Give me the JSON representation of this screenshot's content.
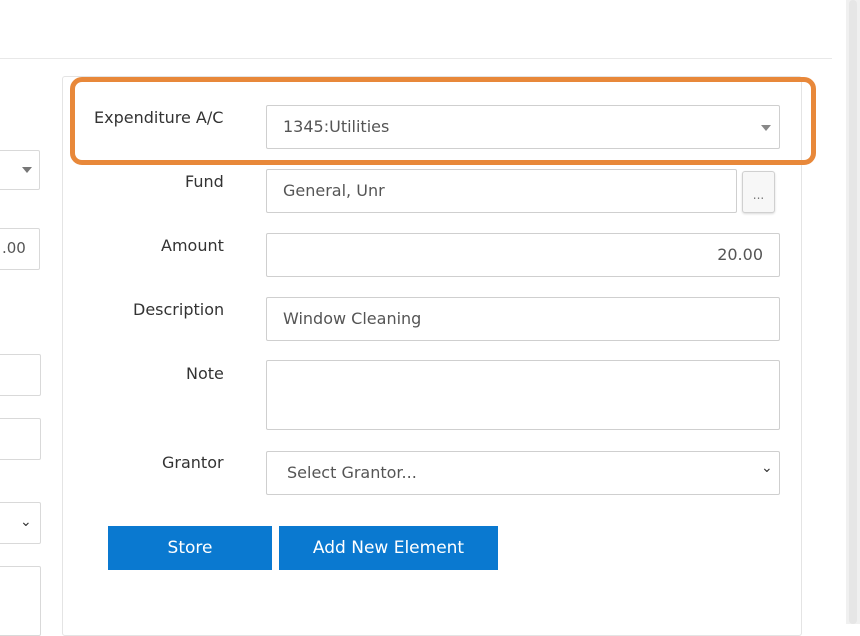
{
  "form": {
    "expenditure_label": "Expenditure A/C",
    "expenditure_value": "1345:Utilities",
    "fund_label": "Fund",
    "fund_value": "General, Unr",
    "fund_lookup": "...",
    "amount_label": "Amount",
    "amount_value": "20.00",
    "description_label": "Description",
    "description_value": "Window Cleaning",
    "note_label": "Note",
    "note_value": "",
    "grantor_label": "Grantor",
    "grantor_placeholder": "Select Grantor..."
  },
  "buttons": {
    "store": "Store",
    "add_new_element": "Add New Element"
  },
  "left_panel": {
    "amount_value": ".00"
  },
  "colors": {
    "highlight": "#e8883a",
    "button_bg": "#0a79d0"
  },
  "icons": {
    "dropdown": "caret-down-icon",
    "select": "chevron-down-icon"
  }
}
